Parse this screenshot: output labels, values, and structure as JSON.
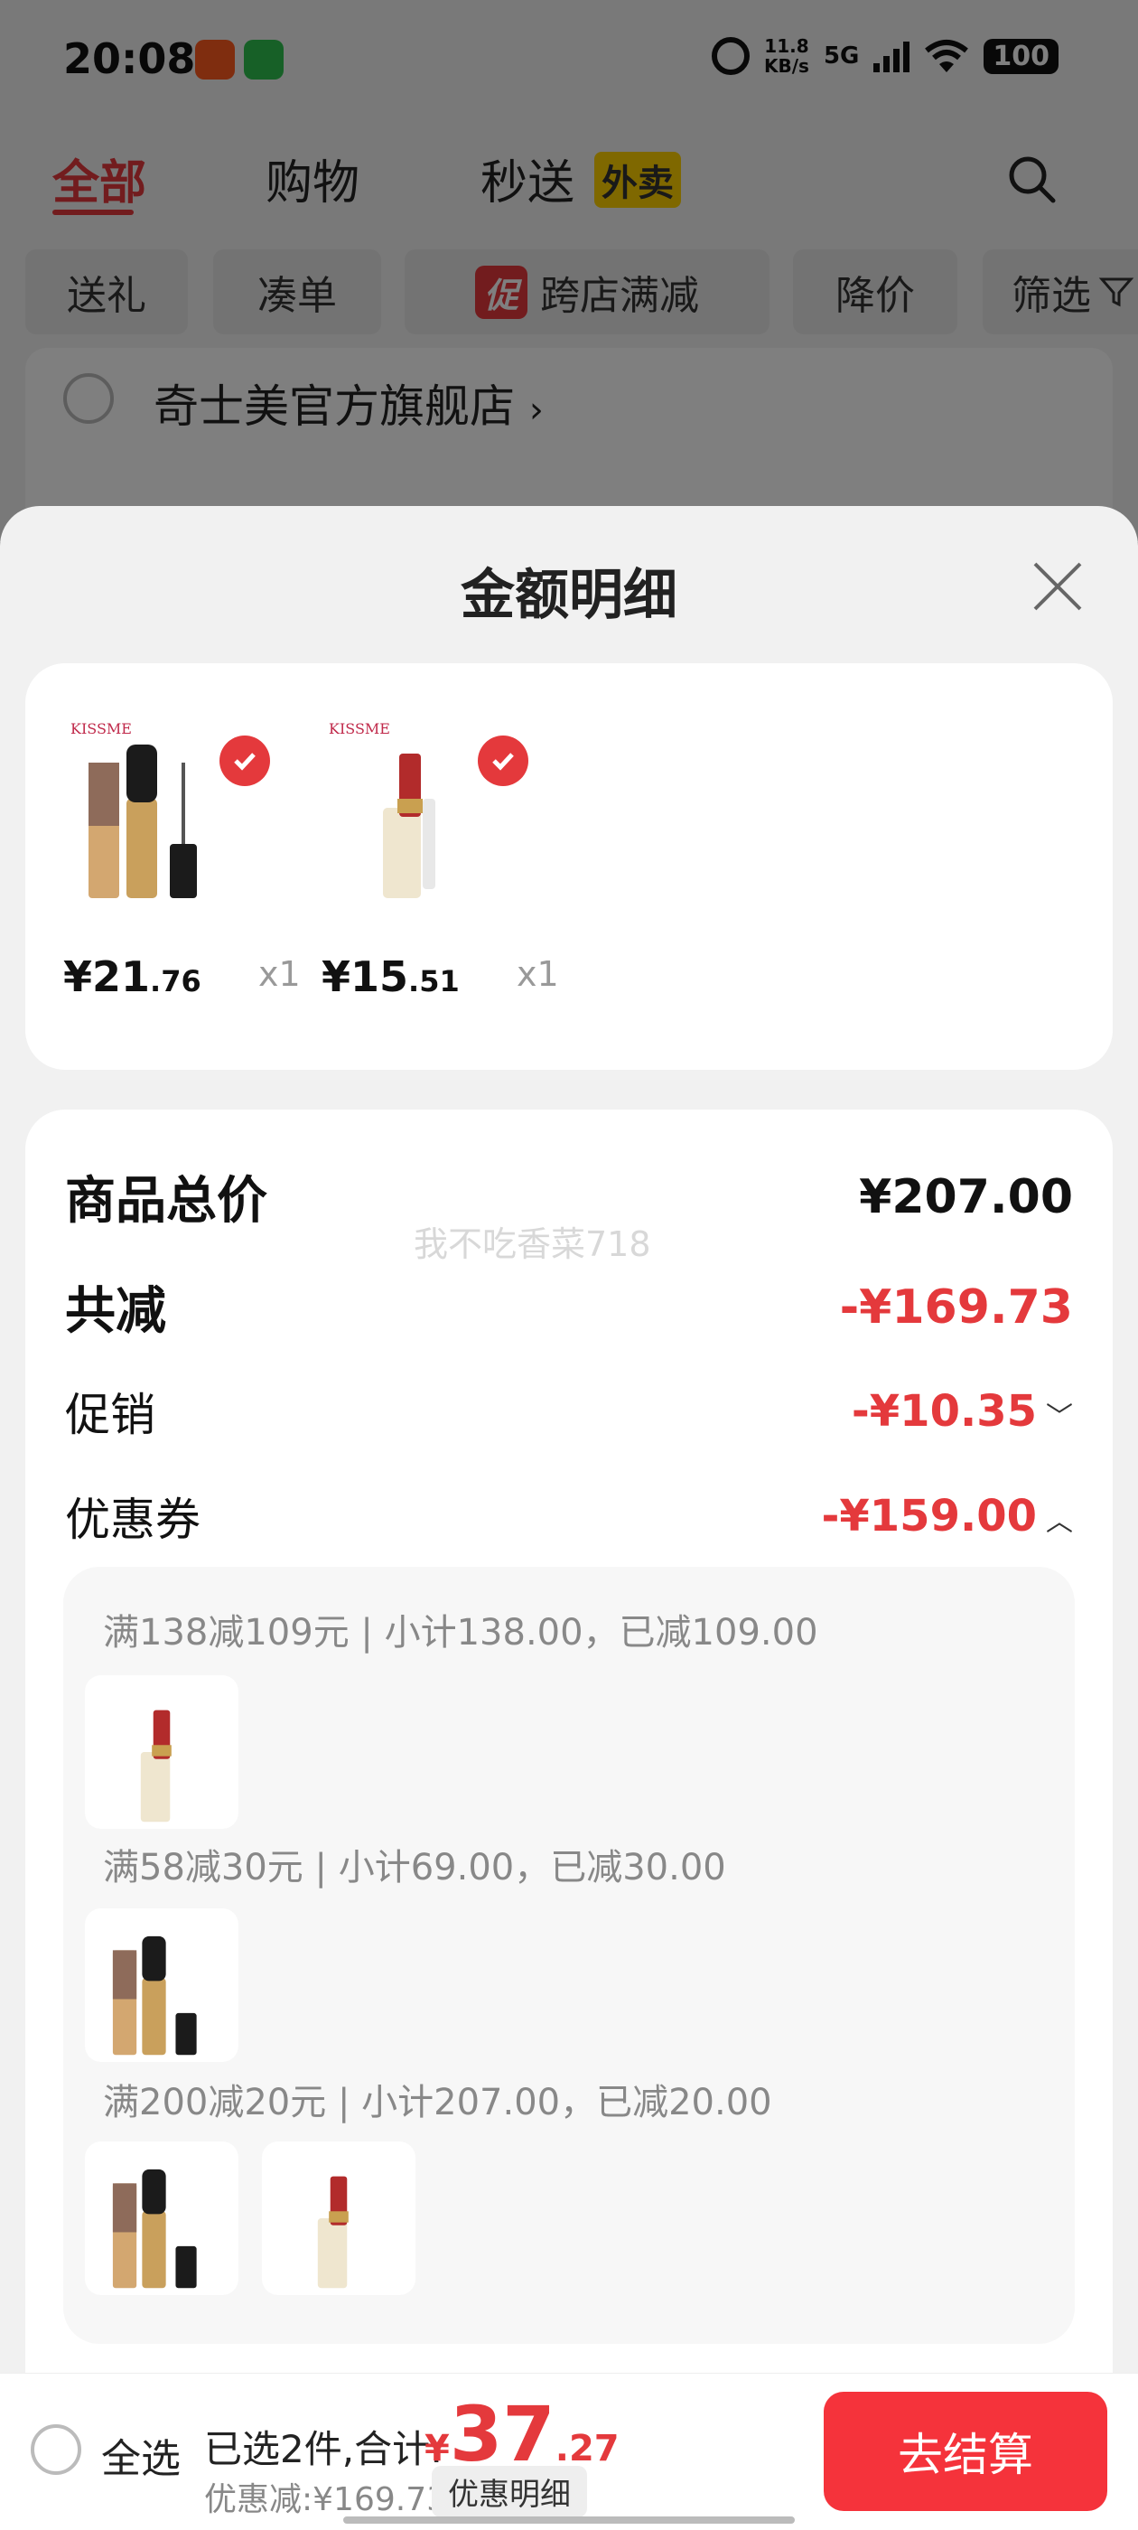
{
  "status_bar": {
    "time": "20:08",
    "net_speed_top": "11.8",
    "net_speed_bottom": "KB/s",
    "signal": "5G",
    "battery": "100"
  },
  "top_tabs": [
    {
      "label": "全部"
    },
    {
      "label": "购物"
    },
    {
      "label": "秒送"
    }
  ],
  "waimai_badge": "外卖",
  "filter_chips": {
    "gift": "送礼",
    "bundle": "凑单",
    "cross_store_badge": "促",
    "cross_store": "跨店满减",
    "price_drop": "降价",
    "filter": "筛选"
  },
  "store": {
    "name": "奇士美官方旗舰店",
    "arrow": "›"
  },
  "sheet": {
    "title": "金额明细",
    "goods": [
      {
        "price_int": "¥21",
        "price_dec": ".76",
        "qty": "x1",
        "brand": "KISSME"
      },
      {
        "price_int": "¥15",
        "price_dec": ".51",
        "qty": "x1",
        "brand": "KISSME"
      }
    ],
    "watermark": "我不吃香菜718",
    "rows": {
      "total_label": "商品总价",
      "total_value": "¥207.00",
      "reduce_label": "共减",
      "reduce_value": "-¥169.73",
      "promo_label": "促销",
      "promo_value": "-¥10.35",
      "coupon_label": "优惠券",
      "coupon_value": "-¥159.00"
    },
    "coupon_rules": [
      {
        "text": "满138减109元 | 小计138.00，已减109.00"
      },
      {
        "text": "满58减30元 | 小计69.00，已减30.00"
      },
      {
        "text": "满200减20元 | 小计207.00，已减20.00"
      }
    ]
  },
  "bottom_bar": {
    "select_all": "全选",
    "selected_text": "已选2件,合计:",
    "currency": "¥",
    "total_int": "37",
    "total_dec": ".27",
    "discount_text": "优惠减:¥169.73",
    "discount_detail_button": "优惠明细",
    "checkout_button": "去结算"
  },
  "colors": {
    "accent_red": "#e4393c",
    "checkout_red": "#f5333b",
    "waimai_yellow": "#ffd000"
  }
}
